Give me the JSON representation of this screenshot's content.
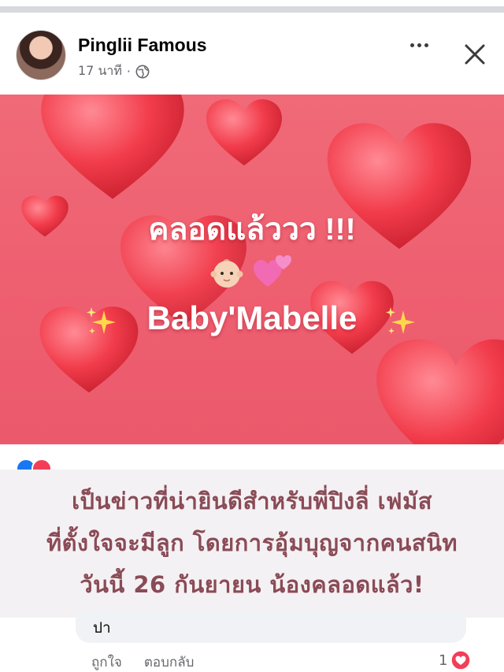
{
  "post": {
    "author": "Pinglii Famous",
    "time": "17 นาที",
    "separator": "·",
    "icons": {
      "privacy": "globe-icon",
      "more": "more-icon",
      "close": "close-icon"
    }
  },
  "image": {
    "headline": "คลอดแล้ววว !!!",
    "name": "Baby'Mabelle",
    "emojis": [
      "baby-face",
      "two-hearts",
      "sparkles"
    ],
    "colors": {
      "background": "#ee6272",
      "heart": "#f5323f",
      "text": "#ffffff"
    }
  },
  "caption": {
    "lines": [
      "เป็นข่าวที่น่ายินดีสำหรับพี่ปิงลี่ เฟมัส",
      "ที่ตั้งใจจะมีลูก โดยการอุ้มบุญจากคนสนิท",
      "วันนี้ 26 กันยายน น้องคลอดแล้ว!"
    ],
    "color": "#8a4b56"
  },
  "comment": {
    "text": "ปา",
    "actions": {
      "like": "ถูกใจ",
      "reply": "ตอบกลับ"
    },
    "like_count": "1"
  }
}
